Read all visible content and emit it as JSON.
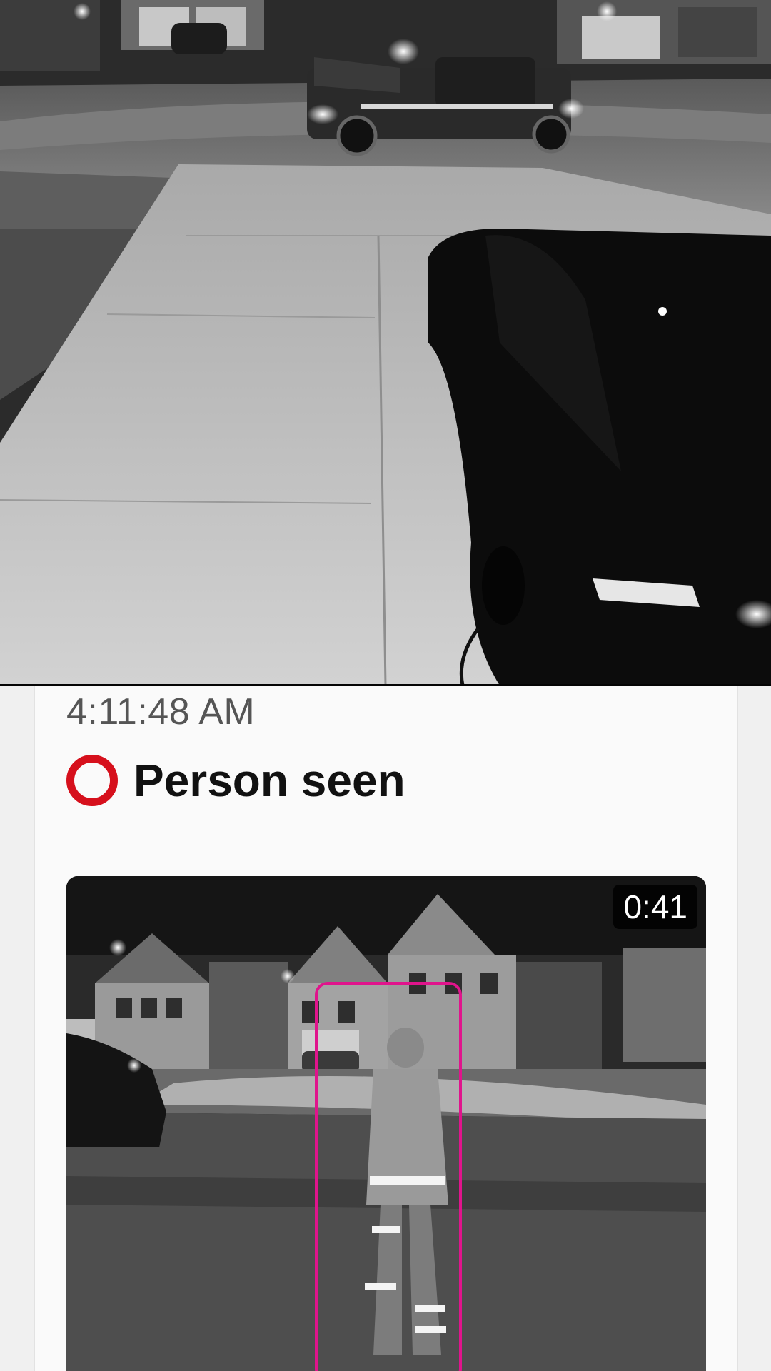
{
  "event": {
    "time": "4:11:48 AM",
    "type": "Person seen",
    "icon": "person-detection-icon",
    "accent_color": "#d6101c"
  },
  "clip": {
    "duration": "0:41",
    "detection_box_color": "#e0148c"
  }
}
